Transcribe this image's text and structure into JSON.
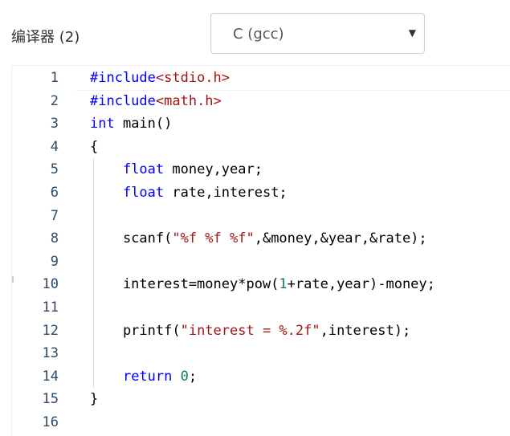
{
  "compiler": {
    "label": "编译器 (2)",
    "selected": "C (gcc)"
  },
  "editor": {
    "lines": [
      {
        "num": "1",
        "tokens": [
          {
            "t": "#include",
            "c": "pre"
          },
          {
            "t": "<stdio.h>",
            "c": "hdr"
          }
        ]
      },
      {
        "num": "2",
        "tokens": [
          {
            "t": "#include",
            "c": "pre"
          },
          {
            "t": "<math.h>",
            "c": "hdr"
          }
        ]
      },
      {
        "num": "3",
        "tokens": [
          {
            "t": "int",
            "c": "type"
          },
          {
            "t": " main()",
            "c": ""
          }
        ]
      },
      {
        "num": "4",
        "tokens": [
          {
            "t": "{",
            "c": ""
          }
        ]
      },
      {
        "num": "5",
        "tokens": [
          {
            "t": "    ",
            "c": ""
          },
          {
            "t": "float",
            "c": "type"
          },
          {
            "t": " money,year;",
            "c": ""
          }
        ]
      },
      {
        "num": "6",
        "tokens": [
          {
            "t": "    ",
            "c": ""
          },
          {
            "t": "float",
            "c": "type"
          },
          {
            "t": " rate,interest;",
            "c": ""
          }
        ]
      },
      {
        "num": "7",
        "tokens": []
      },
      {
        "num": "8",
        "tokens": [
          {
            "t": "    scanf(",
            "c": ""
          },
          {
            "t": "\"%f %f %f\"",
            "c": "str"
          },
          {
            "t": ",&money,&year,&rate);",
            "c": ""
          }
        ]
      },
      {
        "num": "9",
        "tokens": []
      },
      {
        "num": "10",
        "tokens": [
          {
            "t": "    interest=money*pow(",
            "c": ""
          },
          {
            "t": "1",
            "c": "num"
          },
          {
            "t": "+rate,year)-money;",
            "c": ""
          }
        ]
      },
      {
        "num": "11",
        "tokens": []
      },
      {
        "num": "12",
        "tokens": [
          {
            "t": "    printf(",
            "c": ""
          },
          {
            "t": "\"interest = %.2f\"",
            "c": "str"
          },
          {
            "t": ",interest);",
            "c": ""
          }
        ]
      },
      {
        "num": "13",
        "tokens": []
      },
      {
        "num": "14",
        "tokens": [
          {
            "t": "    ",
            "c": ""
          },
          {
            "t": "return",
            "c": "type"
          },
          {
            "t": " ",
            "c": ""
          },
          {
            "t": "0",
            "c": "num"
          },
          {
            "t": ";",
            "c": ""
          }
        ]
      },
      {
        "num": "15",
        "tokens": [
          {
            "t": "}",
            "c": ""
          }
        ]
      },
      {
        "num": "16",
        "tokens": []
      }
    ]
  },
  "colors": {
    "keyword": "#0000ff",
    "string": "#a31515",
    "number": "#098658",
    "line_number": "#2e4a6a"
  }
}
